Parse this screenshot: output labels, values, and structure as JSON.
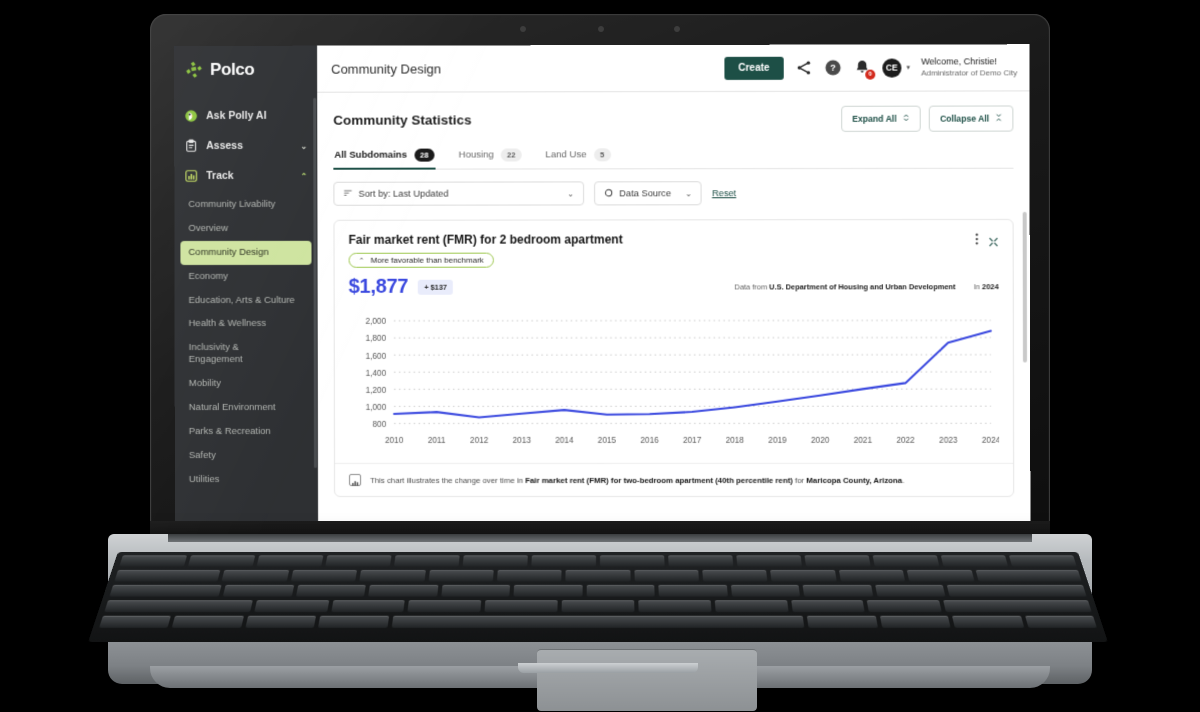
{
  "brand": {
    "name": "Polco",
    "logo_icon": "polco-logo-icon"
  },
  "sidebar": {
    "nav": [
      {
        "label": "Ask Polly AI",
        "icon": "polly-parrot-icon",
        "caret": "",
        "expanded": false
      },
      {
        "label": "Assess",
        "icon": "clipboard-icon",
        "caret": "⌄",
        "expanded": false
      },
      {
        "label": "Track",
        "icon": "bar-chart-icon",
        "caret": "⌃",
        "expanded": true
      }
    ],
    "track_items": [
      {
        "label": "Community Livability",
        "active": false
      },
      {
        "label": "Overview",
        "active": false
      },
      {
        "label": "Community Design",
        "active": true
      },
      {
        "label": "Economy",
        "active": false
      },
      {
        "label": "Education, Arts & Culture",
        "active": false
      },
      {
        "label": "Health & Wellness",
        "active": false
      },
      {
        "label": "Inclusivity & Engagement",
        "active": false
      },
      {
        "label": "Mobility",
        "active": false
      },
      {
        "label": "Natural Environment",
        "active": false
      },
      {
        "label": "Parks & Recreation",
        "active": false
      },
      {
        "label": "Safety",
        "active": false
      },
      {
        "label": "Utilities",
        "active": false
      }
    ]
  },
  "topbar": {
    "title": "Community Design",
    "create_label": "Create",
    "share_icon": "share-icon",
    "help_icon": "help-circle-icon",
    "bell_icon": "bell-icon",
    "notification_count": "0",
    "avatar_initials": "CE",
    "welcome_line1": "Welcome, Christie!",
    "welcome_line2": "Administrator of Demo City"
  },
  "page": {
    "title": "Community Statistics",
    "expand_all": "Expand All",
    "collapse_all": "Collapse All"
  },
  "tabs": [
    {
      "label": "All Subdomains",
      "count": "28",
      "active": true
    },
    {
      "label": "Housing",
      "count": "22",
      "active": false
    },
    {
      "label": "Land Use",
      "count": "5",
      "active": false
    }
  ],
  "filters": {
    "sort_label": "Sort by: Last Updated",
    "sort_icon": "sort-filter-icon",
    "data_source_label": "Data Source",
    "data_source_icon": "circle-icon",
    "reset_label": "Reset",
    "chevron": "⌄"
  },
  "card": {
    "title": "Fair market rent (FMR) for 2 bedroom apartment",
    "benchmark_label": "More favorable than benchmark",
    "benchmark_arrow": "⌃",
    "value": "$1,877",
    "delta": "+ $137",
    "source_prefix": "Data from",
    "source_name": "U.S. Department of Housing and Urban Development",
    "source_year_prefix": "In",
    "source_year": "2024",
    "kebab_icon": "more-options-icon",
    "collapse_icon": "collapse-card-icon",
    "note_icon": "chart-note-icon",
    "note_plain_1": "This chart illustrates the change over time in ",
    "note_bold_1": "Fair market rent (FMR) for two-bedroom apartment (40th percentile rent)",
    "note_plain_2": " for ",
    "note_bold_2": "Maricopa County, Arizona",
    "note_plain_3": "."
  },
  "chart_data": {
    "type": "line",
    "title": "Fair market rent (FMR) for 2 bedroom apartment",
    "xlabel": "",
    "ylabel": "",
    "x": [
      "2010",
      "2011",
      "2012",
      "2013",
      "2014",
      "2015",
      "2016",
      "2017",
      "2018",
      "2019",
      "2020",
      "2021",
      "2022",
      "2023",
      "2024"
    ],
    "series": [
      {
        "name": "Fair market rent (FMR), 2 bedroom, Maricopa County, Arizona",
        "values": [
          912,
          934,
          872,
          915,
          957,
          904,
          910,
          935,
          988,
          1055,
          1125,
          1200,
          1270,
          1740,
          1877
        ],
        "color": "#3b49df"
      }
    ],
    "yticks": [
      800,
      1000,
      1200,
      1400,
      1600,
      1800,
      2000
    ],
    "ytick_labels": [
      "800",
      "1,000",
      "1,200",
      "1,400",
      "1,600",
      "1,800",
      "2,000"
    ],
    "ylim": [
      760,
      2000
    ],
    "grid": true,
    "grid_style": "dotted",
    "legend": "none"
  },
  "colors": {
    "brand_green": "#8dc63f",
    "accent_dark_green": "#1d4f46",
    "series_blue": "#3b49df",
    "sidebar_bg": "#2e3033",
    "active_item_bg": "#cfe4a0",
    "badge_red": "#d32b1e"
  }
}
